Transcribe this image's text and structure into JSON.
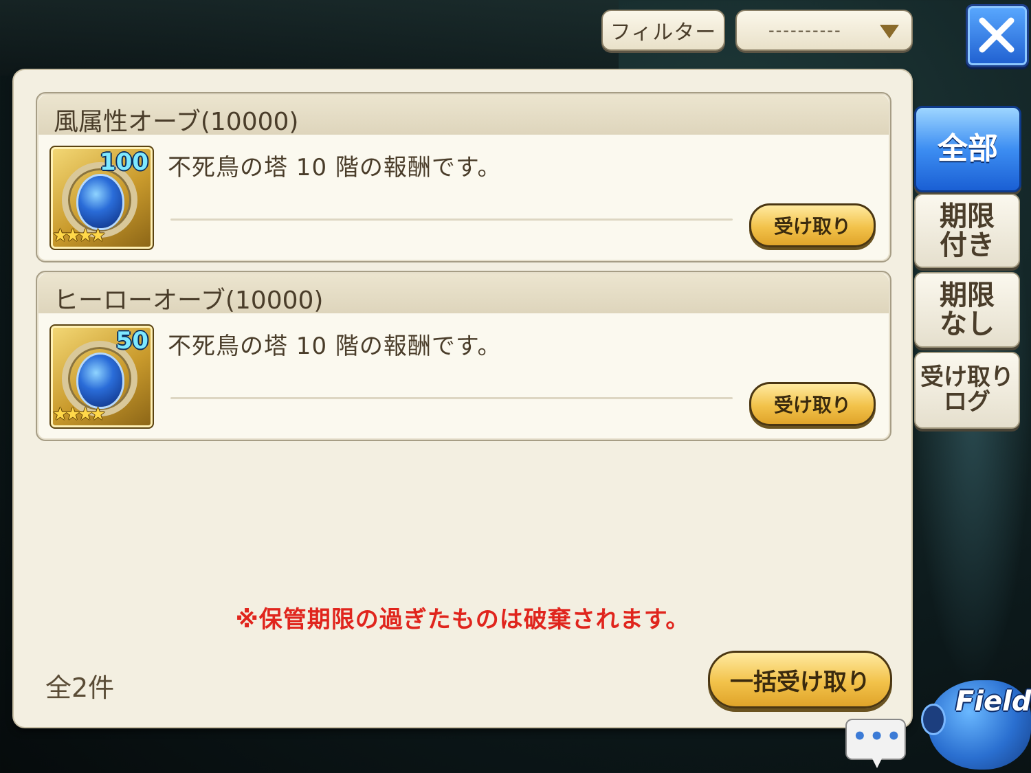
{
  "header": {
    "filter_label": "フィルター",
    "filter_select_value": "----------"
  },
  "items": [
    {
      "title": "風属性オーブ(10000)",
      "count": "100",
      "stars": "★★★★",
      "description": "不死鳥の塔 10 階の報酬です。",
      "claim_label": "受け取り",
      "icon": "wind-orb-icon"
    },
    {
      "title": "ヒーローオーブ(10000)",
      "count": "50",
      "stars": "★★★★",
      "description": "不死鳥の塔 10 階の報酬です。",
      "claim_label": "受け取り",
      "icon": "hero-orb-icon"
    }
  ],
  "notice": "※保管期限の過ぎたものは破棄されます。",
  "total": "全2件",
  "bulk_claim_label": "一括受け取り",
  "tabs": [
    {
      "line1": "全部",
      "line2": ""
    },
    {
      "line1": "期限",
      "line2": "付き"
    },
    {
      "line1": "期限",
      "line2": "なし"
    },
    {
      "line1": "受け取り",
      "line2": "ログ"
    }
  ],
  "chat_dots": "•••",
  "field_label": "Field",
  "colors": {
    "panel_bg": "#f3efe1",
    "notice_red": "#e0251d",
    "accent_blue": "#3d8ef2",
    "button_gold": "#f2c24a"
  }
}
